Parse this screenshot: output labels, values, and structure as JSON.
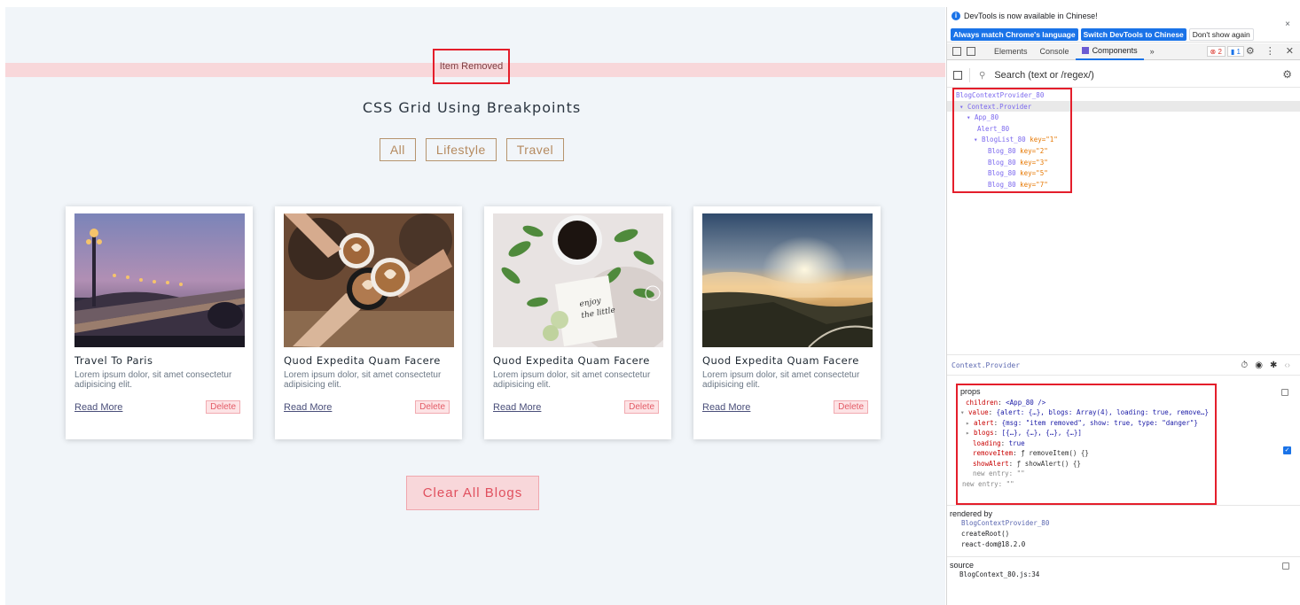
{
  "app": {
    "alert_text": "Item Removed",
    "title": "CSS Grid Using Breakpoints",
    "filters": [
      "All",
      "Lifestyle",
      "Travel"
    ],
    "cards": [
      {
        "title": "Travel To Paris",
        "text": "Lorem ipsum dolor, sit amet consectetur adipisicing elit.",
        "link": "Read More",
        "delete": "Delete"
      },
      {
        "title": "Quod Expedita Quam Facere",
        "text": "Lorem ipsum dolor, sit amet consectetur adipisicing elit.",
        "link": "Read More",
        "delete": "Delete"
      },
      {
        "title": "Quod Expedita Quam Facere",
        "text": "Lorem ipsum dolor, sit amet consectetur adipisicing elit.",
        "link": "Read More",
        "delete": "Delete"
      },
      {
        "title": "Quod Expedita Quam Facere",
        "text": "Lorem ipsum dolor, sit amet consectetur adipisicing elit.",
        "link": "Read More",
        "delete": "Delete"
      }
    ],
    "clear_label": "Clear All Blogs"
  },
  "devtools": {
    "banner_msg": "DevTools is now available in Chinese!",
    "banner_btn1": "Always match Chrome's language",
    "banner_btn2": "Switch DevTools to Chinese",
    "banner_btn3": "Don't show again",
    "banner_close": "×",
    "tabs": [
      "Elements",
      "Console",
      "Components",
      "»"
    ],
    "errors": "2",
    "messages": "1",
    "search_placeholder": "Search (text or /regex/)",
    "tree": [
      {
        "name": "BlogContextProvider_80",
        "key": ""
      },
      {
        "name": "▾ Context.Provider",
        "key": ""
      },
      {
        "name": "▾ App_80",
        "key": ""
      },
      {
        "name": "Alert_80",
        "key": ""
      },
      {
        "name": "▾ BlogList_80",
        "key": "key=\"1\""
      },
      {
        "name": "Blog_80",
        "key": "key=\"2\""
      },
      {
        "name": "Blog_80",
        "key": "key=\"3\""
      },
      {
        "name": "Blog_80",
        "key": "key=\"5\""
      },
      {
        "name": "Blog_80",
        "key": "key=\"7\""
      }
    ],
    "selected": "Context.Provider",
    "props": {
      "title": "props",
      "children_key": "children",
      "children_val": "<App_80 />",
      "value_key": "value",
      "value_val": "{alert: {…}, blogs: Array(4), loading: true, remove…}",
      "alert_key": "alert",
      "alert_val": "{msg: \"item removed\", show: true, type: \"danger\"}",
      "blogs_key": "blogs",
      "blogs_val": "[{…}, {…}, {…}, {…}]",
      "loading_key": "loading",
      "loading_val": "true",
      "remove_key": "removeItem",
      "remove_val": "ƒ removeItem() {}",
      "show_key": "showAlert",
      "show_val": "ƒ showAlert() {}",
      "new_entry_inner": "new entry: \"\"",
      "new_entry_outer": "new entry: \"\""
    },
    "rendered_by": {
      "title": "rendered by",
      "lines": [
        "BlogContextProvider_80",
        "createRoot()",
        "react-dom@18.2.0"
      ]
    },
    "source": {
      "title": "source",
      "file": "BlogContext_80.js:34"
    }
  },
  "colors": {
    "alert_bg": "#f8d7da",
    "highlight_border": "#e41e2b",
    "devtools_accent": "#1a73e8",
    "filter_gold": "#b58a5f"
  }
}
